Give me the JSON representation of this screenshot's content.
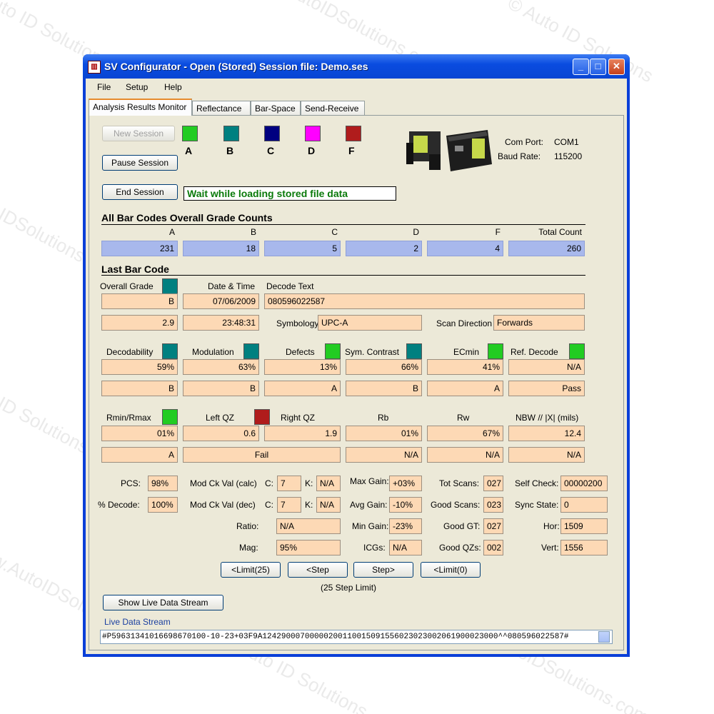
{
  "watermark": {
    "text_a": "© Auto ID Solutions",
    "text_b": "www.AutoIDSolutions.com"
  },
  "window": {
    "title": "SV Configurator  -  Open (Stored) Session file: Demo.ses",
    "controls": {
      "minimize": "_",
      "maximize": "□",
      "close": "✕"
    }
  },
  "menu": [
    "File",
    "Setup",
    "Help"
  ],
  "tabs": [
    "Analysis Results Monitor",
    "Reflectance",
    "Bar-Space",
    "Send-Receive"
  ],
  "buttons": {
    "new_session": "New Session",
    "pause_session": "Pause Session",
    "end_session": "End Session",
    "limit25": "<Limit(25)",
    "step_back": "<Step",
    "step_fwd": "Step>",
    "limit0": "<Limit(0)",
    "show_live": "Show Live Data Stream"
  },
  "grade_swatches": [
    {
      "label": "A",
      "color": "#22cc22"
    },
    {
      "label": "B",
      "color": "#008080"
    },
    {
      "label": "C",
      "color": "#000080"
    },
    {
      "label": "D",
      "color": "#ff00ff"
    },
    {
      "label": "F",
      "color": "#b01c1c"
    }
  ],
  "status_message": "Wait while loading stored file data",
  "comm": {
    "port_label": "Com Port:",
    "port_value": "COM1",
    "baud_label": "Baud Rate:",
    "baud_value": "115200"
  },
  "overall_counts": {
    "title": "All Bar Codes Overall Grade Counts",
    "headers": [
      "A",
      "B",
      "C",
      "D",
      "F",
      "Total Count"
    ],
    "values": [
      "231",
      "18",
      "5",
      "2",
      "4",
      "260"
    ]
  },
  "last_bar_code": {
    "title": "Last Bar Code",
    "overall_grade_label": "Overall Grade",
    "overall_grade": "B",
    "overall_grade_value": "2.9",
    "date_time_label": "Date & Time",
    "date": "07/06/2009",
    "time": "23:48:31",
    "decode_text_label": "Decode Text",
    "decode_text": "080596022587",
    "symbology_label": "Symbology",
    "symbology": "UPC-A",
    "scan_direction_label": "Scan Direction",
    "scan_direction": "Forwards"
  },
  "params_row1": [
    {
      "label": "Decodability",
      "value": "59%",
      "grade": "B",
      "color": "#008080"
    },
    {
      "label": "Modulation",
      "value": "63%",
      "grade": "B",
      "color": "#008080"
    },
    {
      "label": "Defects",
      "value": "13%",
      "grade": "A",
      "color": "#22cc22"
    },
    {
      "label": "Sym. Contrast",
      "value": "66%",
      "grade": "B",
      "color": "#008080"
    },
    {
      "label": "ECmin",
      "value": "41%",
      "grade": "A",
      "color": "#22cc22"
    },
    {
      "label": "Ref. Decode",
      "value": "N/A",
      "grade": "Pass",
      "color": "#22cc22"
    }
  ],
  "params_row2": {
    "rmin_label": "Rmin/Rmax",
    "rmin_value": "01%",
    "rmin_grade": "A",
    "rmin_color": "#22cc22",
    "leftqz_label": "Left QZ",
    "leftqz_value": "0.6",
    "leftqz_color": "#b01c1c",
    "rightqz_label": "Right QZ",
    "rightqz_value": "1.9",
    "qz_grade": "Fail",
    "rb_label": "Rb",
    "rb_value": "01%",
    "rb_grade": "N/A",
    "rw_label": "Rw",
    "rw_value": "67%",
    "rw_grade": "N/A",
    "nbw_label": "NBW // |X| (mils)",
    "nbw_value": "12.4",
    "nbw_grade": "N/A"
  },
  "details": {
    "pcs_label": "PCS:",
    "pcs": "98%",
    "decode_label": "% Decode:",
    "decode": "100%",
    "modck_calc_label": "Mod Ck Val (calc)",
    "modck_dec_label": "Mod Ck Val (dec)",
    "c_label": "C:",
    "k_label": "K:",
    "calc_c": "7",
    "calc_k": "N/A",
    "dec_c": "7",
    "dec_k": "N/A",
    "ratio_label": "Ratio:",
    "ratio": "N/A",
    "mag_label": "Mag:",
    "mag": "95%",
    "maxgain_label": "Max Gain:",
    "maxgain": "+03%",
    "avggain_label": "Avg Gain:",
    "avggain": "-10%",
    "mingain_label": "Min Gain:",
    "mingain": "-23%",
    "icgs_label": "ICGs:",
    "icgs": "N/A",
    "totscans_label": "Tot Scans:",
    "totscans": "027",
    "goodscans_label": "Good Scans:",
    "goodscans": "023",
    "goodgt_label": "Good GT:",
    "goodgt": "027",
    "goodqzs_label": "Good QZs:",
    "goodqzs": "002",
    "selfcheck_label": "Self Check:",
    "selfcheck": "00000200",
    "sync_label": "Sync State:",
    "sync": "0",
    "hor_label": "Hor:",
    "hor": "1509",
    "vert_label": "Vert:",
    "vert": "1556"
  },
  "step_limit_note": "(25 Step Limit)",
  "live_stream": {
    "title": "Live Data Stream",
    "text": "#P59631341016698670100-10-23+03F9A12429000700000200110015091556023023002061900023000^^080596022587#"
  }
}
